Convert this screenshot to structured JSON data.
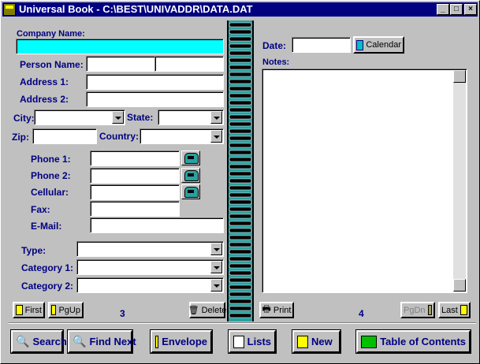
{
  "window": {
    "title": "Universal Book - C:\\BEST\\UNIVADDR\\DATA.DAT"
  },
  "left": {
    "company_label": "Company Name:",
    "person_label": "Person Name:",
    "address1_label": "Address 1:",
    "address2_label": "Address 2:",
    "city_label": "City:",
    "state_label": "State:",
    "zip_label": "Zip:",
    "country_label": "Country:",
    "phone1_label": "Phone 1:",
    "phone2_label": "Phone 2:",
    "cellular_label": "Cellular:",
    "fax_label": "Fax:",
    "email_label": "E-Mail:",
    "type_label": "Type:",
    "category1_label": "Category 1:",
    "category2_label": "Category 2:",
    "first_label": "First",
    "pgup_label": "PgUp",
    "delete_label": "Delete",
    "page_number": "3"
  },
  "right": {
    "date_label": "Date:",
    "calendar_label": "Calendar",
    "notes_label": "Notes:",
    "print_label": "Print",
    "pgdn_label": "PgDn",
    "last_label": "Last",
    "page_number": "4"
  },
  "toolbar": {
    "search": "Search",
    "find_next": "Find Next",
    "envelope": "Envelope",
    "lists": "Lists",
    "new": "New",
    "toc": "Table of Contents"
  },
  "colors": {
    "title_bar": "#000080",
    "company_field": "#00ffff",
    "label": "#000080",
    "spine": "#2aa0a0"
  }
}
